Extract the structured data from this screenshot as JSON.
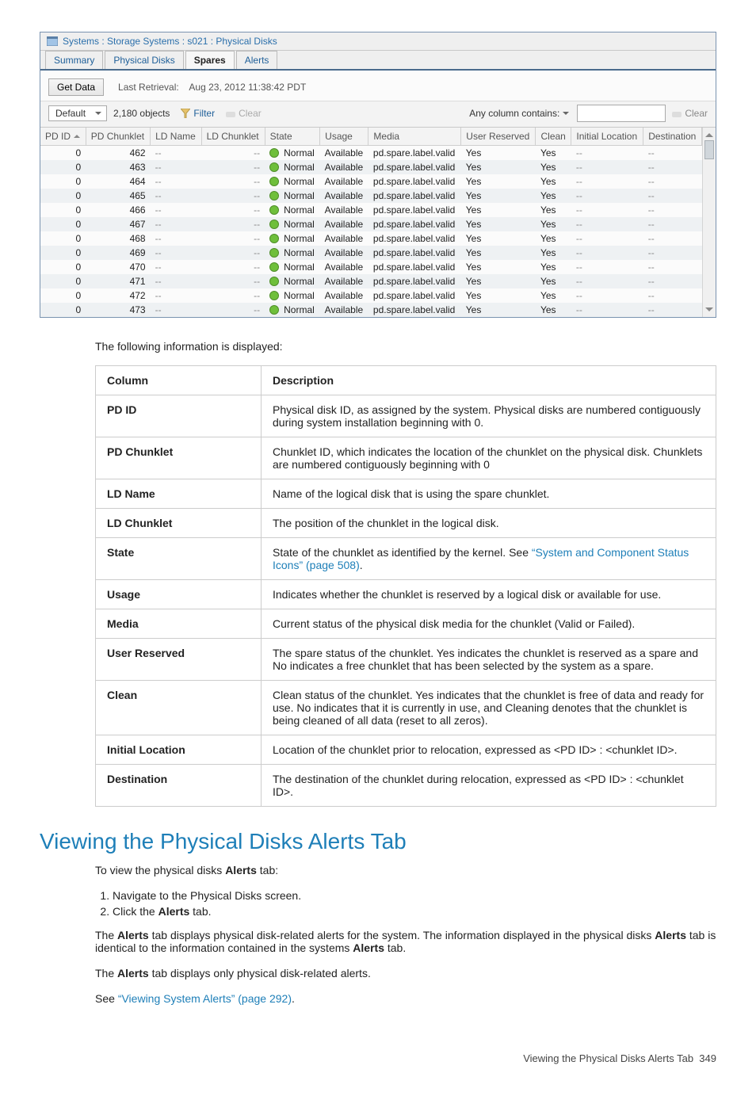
{
  "breadcrumb": "Systems : Storage Systems : s021 : Physical Disks",
  "tabs": [
    "Summary",
    "Physical Disks",
    "Spares",
    "Alerts"
  ],
  "active_tab": 2,
  "toolbar": {
    "get_data": "Get Data",
    "last_retrieval_label": "Last Retrieval:",
    "last_retrieval": "Aug 23, 2012 11:38:42 PDT"
  },
  "toolbar2": {
    "view": "Default",
    "objects": "2,180 objects",
    "filter": "Filter",
    "clear": "Clear",
    "any_column": "Any column contains:",
    "clear2": "Clear"
  },
  "columns": [
    "PD ID",
    "PD Chunklet",
    "LD Name",
    "LD Chunklet",
    "State",
    "Usage",
    "Media",
    "User Reserved",
    "Clean",
    "Initial Location",
    "Destination"
  ],
  "rows": [
    {
      "pd": "0",
      "chk": "462",
      "ldn": "--",
      "ldc": "--",
      "state": "Normal",
      "usage": "Available",
      "media": "pd.spare.label.valid",
      "ur": "Yes",
      "clean": "Yes",
      "init": "--",
      "dest": "--"
    },
    {
      "pd": "0",
      "chk": "463",
      "ldn": "--",
      "ldc": "--",
      "state": "Normal",
      "usage": "Available",
      "media": "pd.spare.label.valid",
      "ur": "Yes",
      "clean": "Yes",
      "init": "--",
      "dest": "--"
    },
    {
      "pd": "0",
      "chk": "464",
      "ldn": "--",
      "ldc": "--",
      "state": "Normal",
      "usage": "Available",
      "media": "pd.spare.label.valid",
      "ur": "Yes",
      "clean": "Yes",
      "init": "--",
      "dest": "--"
    },
    {
      "pd": "0",
      "chk": "465",
      "ldn": "--",
      "ldc": "--",
      "state": "Normal",
      "usage": "Available",
      "media": "pd.spare.label.valid",
      "ur": "Yes",
      "clean": "Yes",
      "init": "--",
      "dest": "--"
    },
    {
      "pd": "0",
      "chk": "466",
      "ldn": "--",
      "ldc": "--",
      "state": "Normal",
      "usage": "Available",
      "media": "pd.spare.label.valid",
      "ur": "Yes",
      "clean": "Yes",
      "init": "--",
      "dest": "--"
    },
    {
      "pd": "0",
      "chk": "467",
      "ldn": "--",
      "ldc": "--",
      "state": "Normal",
      "usage": "Available",
      "media": "pd.spare.label.valid",
      "ur": "Yes",
      "clean": "Yes",
      "init": "--",
      "dest": "--"
    },
    {
      "pd": "0",
      "chk": "468",
      "ldn": "--",
      "ldc": "--",
      "state": "Normal",
      "usage": "Available",
      "media": "pd.spare.label.valid",
      "ur": "Yes",
      "clean": "Yes",
      "init": "--",
      "dest": "--"
    },
    {
      "pd": "0",
      "chk": "469",
      "ldn": "--",
      "ldc": "--",
      "state": "Normal",
      "usage": "Available",
      "media": "pd.spare.label.valid",
      "ur": "Yes",
      "clean": "Yes",
      "init": "--",
      "dest": "--"
    },
    {
      "pd": "0",
      "chk": "470",
      "ldn": "--",
      "ldc": "--",
      "state": "Normal",
      "usage": "Available",
      "media": "pd.spare.label.valid",
      "ur": "Yes",
      "clean": "Yes",
      "init": "--",
      "dest": "--"
    },
    {
      "pd": "0",
      "chk": "471",
      "ldn": "--",
      "ldc": "--",
      "state": "Normal",
      "usage": "Available",
      "media": "pd.spare.label.valid",
      "ur": "Yes",
      "clean": "Yes",
      "init": "--",
      "dest": "--"
    },
    {
      "pd": "0",
      "chk": "472",
      "ldn": "--",
      "ldc": "--",
      "state": "Normal",
      "usage": "Available",
      "media": "pd.spare.label.valid",
      "ur": "Yes",
      "clean": "Yes",
      "init": "--",
      "dest": "--"
    },
    {
      "pd": "0",
      "chk": "473",
      "ldn": "--",
      "ldc": "--",
      "state": "Normal",
      "usage": "Available",
      "media": "pd.spare.label.valid",
      "ur": "Yes",
      "clean": "Yes",
      "init": "--",
      "dest": "--"
    }
  ],
  "intro": "The following information is displayed:",
  "info_header": {
    "c1": "Column",
    "c2": "Description"
  },
  "info": [
    {
      "c": "PD ID",
      "d": "Physical disk ID, as assigned by the system. Physical disks are numbered contiguously during system installation beginning with 0."
    },
    {
      "c": "PD Chunklet",
      "d": "Chunklet ID, which indicates the location of the chunklet on the physical disk. Chunklets are numbered contiguously beginning with 0"
    },
    {
      "c": "LD Name",
      "d": "Name of the logical disk that is using the spare chunklet."
    },
    {
      "c": "LD Chunklet",
      "d": "The position of the chunklet in the logical disk."
    },
    {
      "c": "State",
      "d_pre": "State of the chunklet as identified by the kernel. See ",
      "link": "“System and Component Status Icons” (page 508)",
      "d_post": "."
    },
    {
      "c": "Usage",
      "d": "Indicates whether the chunklet is reserved by a logical disk or available for use."
    },
    {
      "c": "Media",
      "d": "Current status of the physical disk media for the chunklet (Valid or Failed)."
    },
    {
      "c": "User Reserved",
      "d": "The spare status of the chunklet. Yes indicates the chunklet is reserved as a spare and No indicates a free chunklet that has been selected by the system as a spare."
    },
    {
      "c": "Clean",
      "d": "Clean status of the chunklet. Yes indicates that the chunklet is free of data and ready for use. No indicates that it is currently in use, and Cleaning denotes that the chunklet is being cleaned of all data (reset to all zeros)."
    },
    {
      "c": "Initial Location",
      "d": "Location of the chunklet prior to relocation, expressed as <PD ID> : <chunklet ID>."
    },
    {
      "c": "Destination",
      "d": "The destination of the chunklet during relocation, expressed as <PD ID> : <chunklet ID>."
    }
  ],
  "section_title": "Viewing the Physical Disks Alerts Tab",
  "sec_intro_pre": "To view the physical disks ",
  "sec_intro_bold": "Alerts",
  "sec_intro_post": " tab:",
  "steps": [
    {
      "t": "Navigate to the Physical Disks screen."
    },
    {
      "pre": "Click the ",
      "b": "Alerts",
      "post": " tab."
    }
  ],
  "p1": {
    "pre": "The ",
    "b1": "Alerts",
    "mid": " tab displays physical disk-related alerts for the system. The information displayed in the physical disks ",
    "b2": "Alerts",
    "mid2": " tab is identical to the information contained in the systems ",
    "b3": "Alerts",
    "post": " tab."
  },
  "p2": {
    "pre": "The ",
    "b": "Alerts",
    "post": " tab displays only physical disk-related alerts."
  },
  "p3": {
    "pre": "See ",
    "link": "“Viewing System Alerts” (page 292)",
    "post": "."
  },
  "footer": {
    "text": "Viewing the Physical Disks Alerts Tab",
    "page": "349"
  }
}
